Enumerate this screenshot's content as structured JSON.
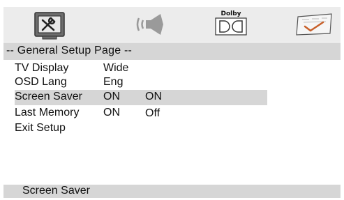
{
  "tabs": [
    {
      "icon": "general-setup-icon",
      "active": true
    },
    {
      "icon": "speaker-audio-icon",
      "active": false
    },
    {
      "icon": "dolby-icon",
      "label": "Dolby",
      "active": false
    },
    {
      "icon": "preferences-check-icon",
      "active": false
    }
  ],
  "page_title": "-- General Setup Page --",
  "menu": [
    {
      "label": "TV Display",
      "value": "Wide"
    },
    {
      "label": "OSD Lang",
      "value": "Eng"
    },
    {
      "label": "Screen Saver",
      "value": "ON",
      "selected": true
    },
    {
      "label": "Last Memory",
      "value": "ON"
    },
    {
      "label": "Exit Setup"
    }
  ],
  "submenu_options": [
    "ON",
    "Off"
  ],
  "status_text": "Screen Saver",
  "colors": {
    "icon_bar": "#ececec",
    "title_bar": "#d6d6d6",
    "highlight": "#d6d6d6",
    "status_bar": "#d6d6d6",
    "text": "#111111"
  }
}
